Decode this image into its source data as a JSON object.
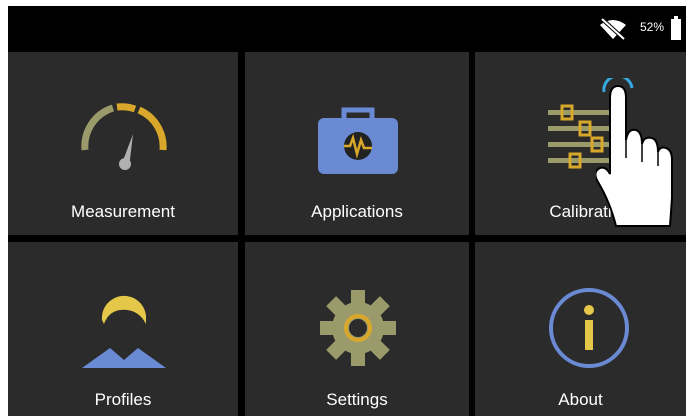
{
  "status_bar": {
    "wifi_icon": "wifi-off-icon",
    "battery_percent": "52%",
    "battery_icon": "battery-icon"
  },
  "tiles": [
    {
      "label": "Measurement",
      "icon": "gauge-icon"
    },
    {
      "label": "Applications",
      "icon": "medical-case-icon"
    },
    {
      "label": "Calibrati",
      "icon": "calibration-sliders-icon"
    },
    {
      "label": "Profiles",
      "icon": "user-profile-icon"
    },
    {
      "label": "Settings",
      "icon": "gear-icon"
    },
    {
      "label": "About",
      "icon": "info-icon"
    }
  ],
  "colors": {
    "background": "#000000",
    "tile": "#2b2b2b",
    "olive": "#9a9a6a",
    "gold": "#d9a82b",
    "blue": "#6a8ad4",
    "yellow": "#e5c84a",
    "touch_ring": "#35a8e0"
  },
  "overlay": {
    "icon": "hand-pointer-icon"
  }
}
